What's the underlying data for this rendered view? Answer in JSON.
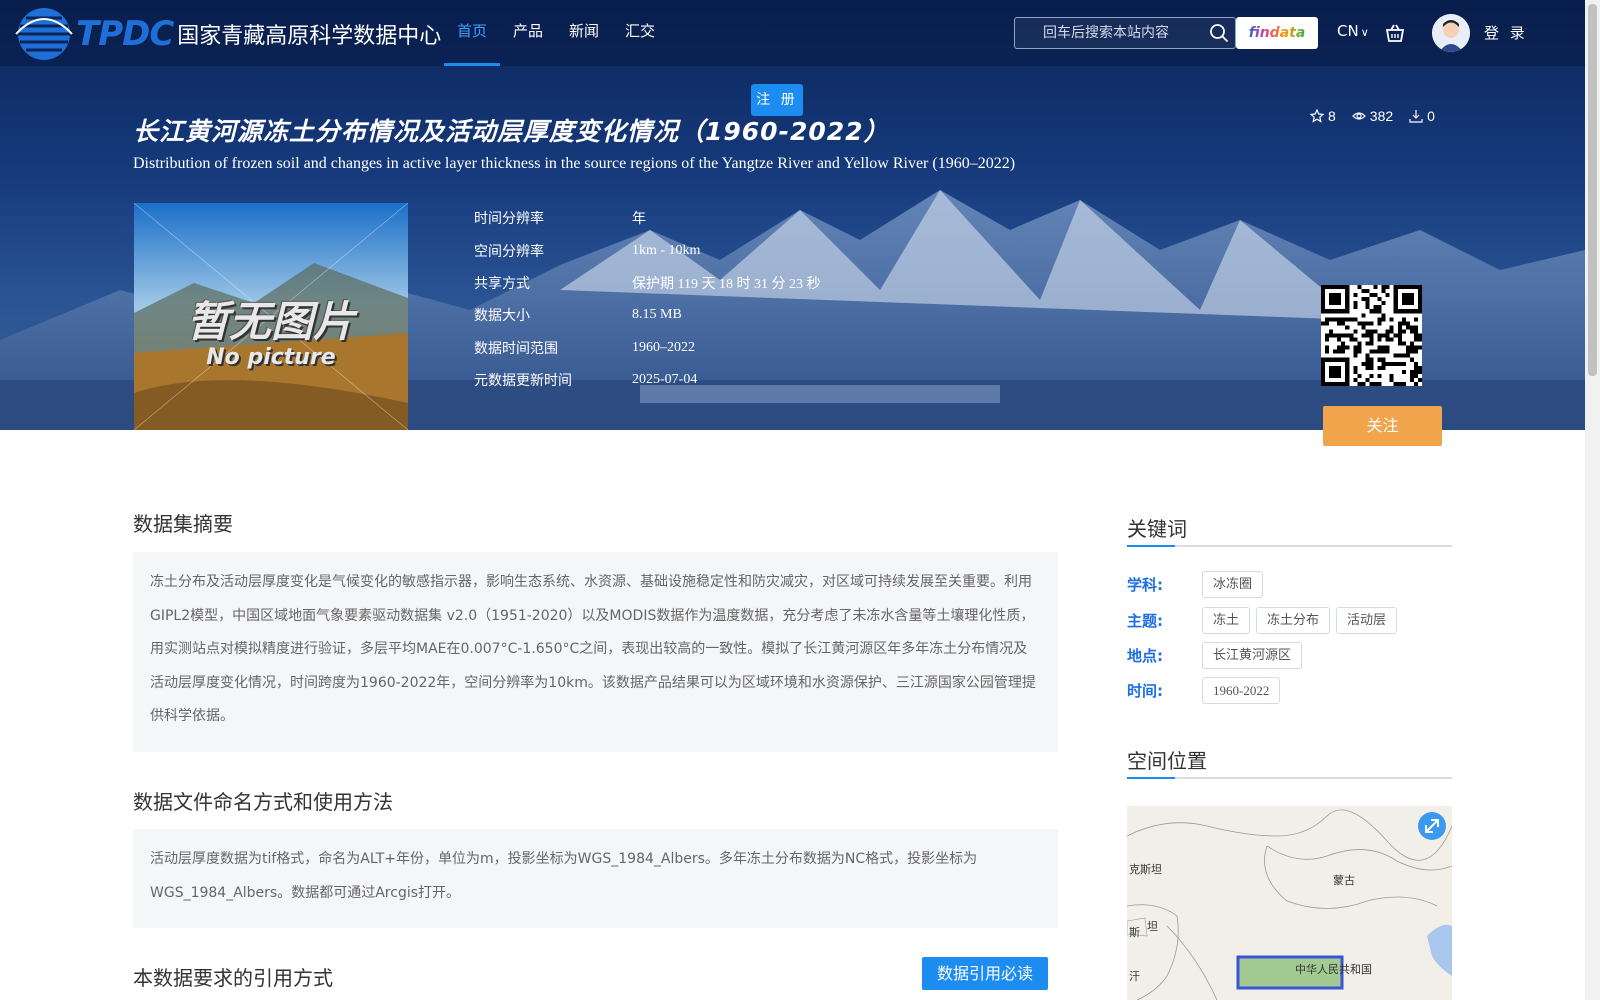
{
  "header": {
    "logo_en": "TPDC",
    "logo_cn": "国家青藏高原科学数据中心",
    "nav": [
      {
        "label": "首页",
        "active": true
      },
      {
        "label": "产品",
        "active": false
      },
      {
        "label": "新闻",
        "active": false
      },
      {
        "label": "汇交",
        "active": false
      }
    ],
    "search_placeholder": "回车后搜索本站内容",
    "findata_label": "findata",
    "lang_label": "CN",
    "login_label": "登 录",
    "register_label": "注 册"
  },
  "dataset": {
    "title_cn": "长江黄河源冻土分布情况及活动层厚度变化情况（1960-2022）",
    "title_en": "Distribution of frozen soil and changes in active layer thickness in the source regions of the Yangtze River and Yellow River (1960–2022)",
    "stats": {
      "stars": "8",
      "views": "382",
      "downloads": "0"
    },
    "cover_text_cn": "暂无图片",
    "cover_text_en": "No picture",
    "meta": [
      {
        "label": "时间分辨率",
        "value": "年"
      },
      {
        "label": "空间分辨率",
        "value": "1km - 10km"
      },
      {
        "label": "共享方式",
        "value": "保护期 119 天 18 时 31 分 23 秒"
      },
      {
        "label": "数据大小",
        "value": "8.15 MB"
      },
      {
        "label": "数据时间范围",
        "value": "1960–2022"
      },
      {
        "label": "元数据更新时间",
        "value": "2025-07-04"
      }
    ],
    "follow_label": "关注"
  },
  "main": {
    "abstract_title": "数据集摘要",
    "abstract_text": "冻土分布及活动层厚度变化是气候变化的敏感指示器，影响生态系统、水资源、基础设施稳定性和防灾减灾，对区域可持续发展至关重要。利用GIPL2模型，中国区域地面气象要素驱动数据集 v2.0（1951-2020）以及MODIS数据作为温度数据，充分考虑了未冻水含量等土壤理化性质，用实测站点对模拟精度进行验证，多层平均MAE在0.007°C-1.650°C之间，表现出较高的一致性。模拟了长江黄河源区年多年冻土分布情况及活动层厚度变化情况，时间跨度为1960-2022年，空间分辨率为10km。该数据产品结果可以为区域环境和水资源保护、三江源国家公园管理提供科学依据。",
    "naming_title": "数据文件命名方式和使用方法",
    "naming_text": "活动层厚度数据为tif格式，命名为ALT+年份，单位为m，投影坐标为WGS_1984_Albers。多年冻土分布数据为NC格式，投影坐标为WGS_1984_Albers。数据都可通过Arcgis打开。",
    "citation_title": "本数据要求的引用方式",
    "citation_button": "数据引用必读"
  },
  "sidebar": {
    "keywords_title": "关键词",
    "keywords": [
      {
        "label": "学科:",
        "tags": [
          "冰冻圈"
        ]
      },
      {
        "label": "主题:",
        "tags": [
          "冻土",
          "冻土分布",
          "活动层"
        ]
      },
      {
        "label": "地点:",
        "tags": [
          "长江黄河源区"
        ]
      },
      {
        "label": "时间:",
        "tags": [
          "1960-2022"
        ]
      }
    ],
    "location_title": "空间位置",
    "map_labels": [
      "克斯坦",
      "蒙古",
      "斯",
      "坦",
      "汗",
      "中华人民共和国"
    ]
  }
}
